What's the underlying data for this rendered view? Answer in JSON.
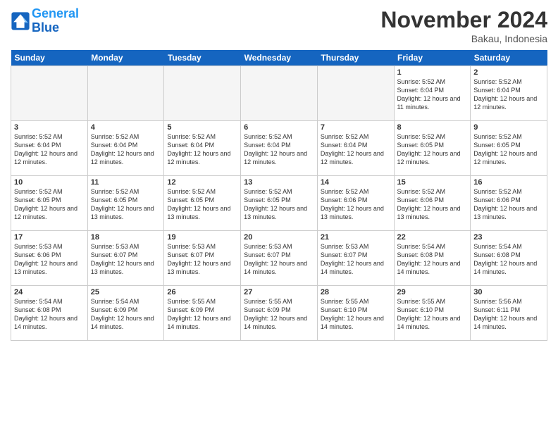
{
  "header": {
    "logo_line1": "General",
    "logo_line2": "Blue",
    "month": "November 2024",
    "location": "Bakau, Indonesia"
  },
  "weekdays": [
    "Sunday",
    "Monday",
    "Tuesday",
    "Wednesday",
    "Thursday",
    "Friday",
    "Saturday"
  ],
  "weeks": [
    [
      {
        "day": "",
        "info": ""
      },
      {
        "day": "",
        "info": ""
      },
      {
        "day": "",
        "info": ""
      },
      {
        "day": "",
        "info": ""
      },
      {
        "day": "",
        "info": ""
      },
      {
        "day": "1",
        "info": "Sunrise: 5:52 AM\nSunset: 6:04 PM\nDaylight: 12 hours\nand 11 minutes."
      },
      {
        "day": "2",
        "info": "Sunrise: 5:52 AM\nSunset: 6:04 PM\nDaylight: 12 hours\nand 12 minutes."
      }
    ],
    [
      {
        "day": "3",
        "info": "Sunrise: 5:52 AM\nSunset: 6:04 PM\nDaylight: 12 hours\nand 12 minutes."
      },
      {
        "day": "4",
        "info": "Sunrise: 5:52 AM\nSunset: 6:04 PM\nDaylight: 12 hours\nand 12 minutes."
      },
      {
        "day": "5",
        "info": "Sunrise: 5:52 AM\nSunset: 6:04 PM\nDaylight: 12 hours\nand 12 minutes."
      },
      {
        "day": "6",
        "info": "Sunrise: 5:52 AM\nSunset: 6:04 PM\nDaylight: 12 hours\nand 12 minutes."
      },
      {
        "day": "7",
        "info": "Sunrise: 5:52 AM\nSunset: 6:04 PM\nDaylight: 12 hours\nand 12 minutes."
      },
      {
        "day": "8",
        "info": "Sunrise: 5:52 AM\nSunset: 6:05 PM\nDaylight: 12 hours\nand 12 minutes."
      },
      {
        "day": "9",
        "info": "Sunrise: 5:52 AM\nSunset: 6:05 PM\nDaylight: 12 hours\nand 12 minutes."
      }
    ],
    [
      {
        "day": "10",
        "info": "Sunrise: 5:52 AM\nSunset: 6:05 PM\nDaylight: 12 hours\nand 12 minutes."
      },
      {
        "day": "11",
        "info": "Sunrise: 5:52 AM\nSunset: 6:05 PM\nDaylight: 12 hours\nand 13 minutes."
      },
      {
        "day": "12",
        "info": "Sunrise: 5:52 AM\nSunset: 6:05 PM\nDaylight: 12 hours\nand 13 minutes."
      },
      {
        "day": "13",
        "info": "Sunrise: 5:52 AM\nSunset: 6:05 PM\nDaylight: 12 hours\nand 13 minutes."
      },
      {
        "day": "14",
        "info": "Sunrise: 5:52 AM\nSunset: 6:06 PM\nDaylight: 12 hours\nand 13 minutes."
      },
      {
        "day": "15",
        "info": "Sunrise: 5:52 AM\nSunset: 6:06 PM\nDaylight: 12 hours\nand 13 minutes."
      },
      {
        "day": "16",
        "info": "Sunrise: 5:52 AM\nSunset: 6:06 PM\nDaylight: 12 hours\nand 13 minutes."
      }
    ],
    [
      {
        "day": "17",
        "info": "Sunrise: 5:53 AM\nSunset: 6:06 PM\nDaylight: 12 hours\nand 13 minutes."
      },
      {
        "day": "18",
        "info": "Sunrise: 5:53 AM\nSunset: 6:07 PM\nDaylight: 12 hours\nand 13 minutes."
      },
      {
        "day": "19",
        "info": "Sunrise: 5:53 AM\nSunset: 6:07 PM\nDaylight: 12 hours\nand 13 minutes."
      },
      {
        "day": "20",
        "info": "Sunrise: 5:53 AM\nSunset: 6:07 PM\nDaylight: 12 hours\nand 14 minutes."
      },
      {
        "day": "21",
        "info": "Sunrise: 5:53 AM\nSunset: 6:07 PM\nDaylight: 12 hours\nand 14 minutes."
      },
      {
        "day": "22",
        "info": "Sunrise: 5:54 AM\nSunset: 6:08 PM\nDaylight: 12 hours\nand 14 minutes."
      },
      {
        "day": "23",
        "info": "Sunrise: 5:54 AM\nSunset: 6:08 PM\nDaylight: 12 hours\nand 14 minutes."
      }
    ],
    [
      {
        "day": "24",
        "info": "Sunrise: 5:54 AM\nSunset: 6:08 PM\nDaylight: 12 hours\nand 14 minutes."
      },
      {
        "day": "25",
        "info": "Sunrise: 5:54 AM\nSunset: 6:09 PM\nDaylight: 12 hours\nand 14 minutes."
      },
      {
        "day": "26",
        "info": "Sunrise: 5:55 AM\nSunset: 6:09 PM\nDaylight: 12 hours\nand 14 minutes."
      },
      {
        "day": "27",
        "info": "Sunrise: 5:55 AM\nSunset: 6:09 PM\nDaylight: 12 hours\nand 14 minutes."
      },
      {
        "day": "28",
        "info": "Sunrise: 5:55 AM\nSunset: 6:10 PM\nDaylight: 12 hours\nand 14 minutes."
      },
      {
        "day": "29",
        "info": "Sunrise: 5:55 AM\nSunset: 6:10 PM\nDaylight: 12 hours\nand 14 minutes."
      },
      {
        "day": "30",
        "info": "Sunrise: 5:56 AM\nSunset: 6:11 PM\nDaylight: 12 hours\nand 14 minutes."
      }
    ]
  ]
}
